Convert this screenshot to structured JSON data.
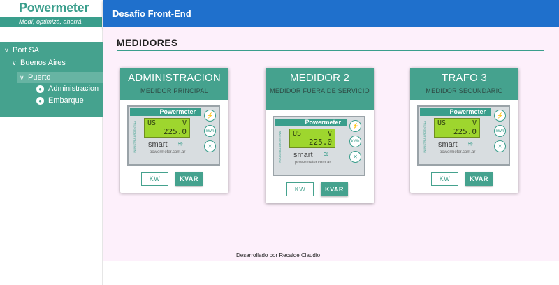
{
  "brand": {
    "name": "Powermeter",
    "tagline": "Medí, optimizá, ahorrá."
  },
  "header": {
    "title": "Desafío Front-End"
  },
  "tree": {
    "company": "Port SA",
    "region": "Buenos Aires",
    "site": "Puerto",
    "sites": [
      "Administracion",
      "Embarque"
    ]
  },
  "main": {
    "section_title": "MEDIDORES",
    "cards": [
      {
        "title": "ADMINISTRACION",
        "subtitle": "MEDIDOR PRINCIPAL",
        "kw_label": "KW",
        "kvar_label": "KVAR"
      },
      {
        "title": "MEDIDOR 2",
        "subtitle": "MEDIDOR FUERA DE SERVICIO",
        "kw_label": "KW",
        "kvar_label": "KVAR"
      },
      {
        "title": "TRAFO 3",
        "subtitle": "MEDIDOR SECUNDARIO",
        "kw_label": "KW",
        "kvar_label": "KVAR"
      }
    ],
    "meter": {
      "brand": "Powermeter",
      "lcd_left": "US",
      "lcd_right": "V",
      "lcd_value": "225.0",
      "smart": "smart",
      "url": "powermeter.com.ar",
      "side_text": "INDUSTRIA ARGENTINA",
      "btn_icons": [
        "bolt-icon",
        "kwh-icon",
        "tools-icon"
      ],
      "kwh_label": "kWh"
    }
  },
  "footer": {
    "text": "Desarrollado por Recalde Claudio"
  },
  "colors": {
    "primary": "#45a28e",
    "header": "#1f70cc",
    "background": "#fdf0fb"
  }
}
